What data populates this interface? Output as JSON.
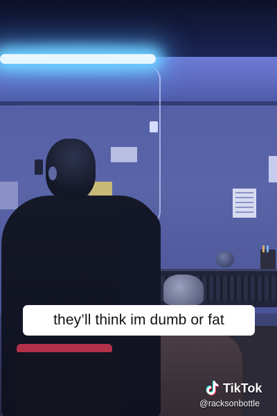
{
  "video": {
    "caption": "they’ll think im dumb or fat"
  },
  "watermark": {
    "brand": "TikTok",
    "handle": "@racksonbottle",
    "logo_icon": "tiktok-note-icon"
  },
  "colors": {
    "led_strip": "#6fd0ff",
    "caption_background": "#ffffff",
    "caption_text": "#111111",
    "waistband": "#b3324a"
  }
}
